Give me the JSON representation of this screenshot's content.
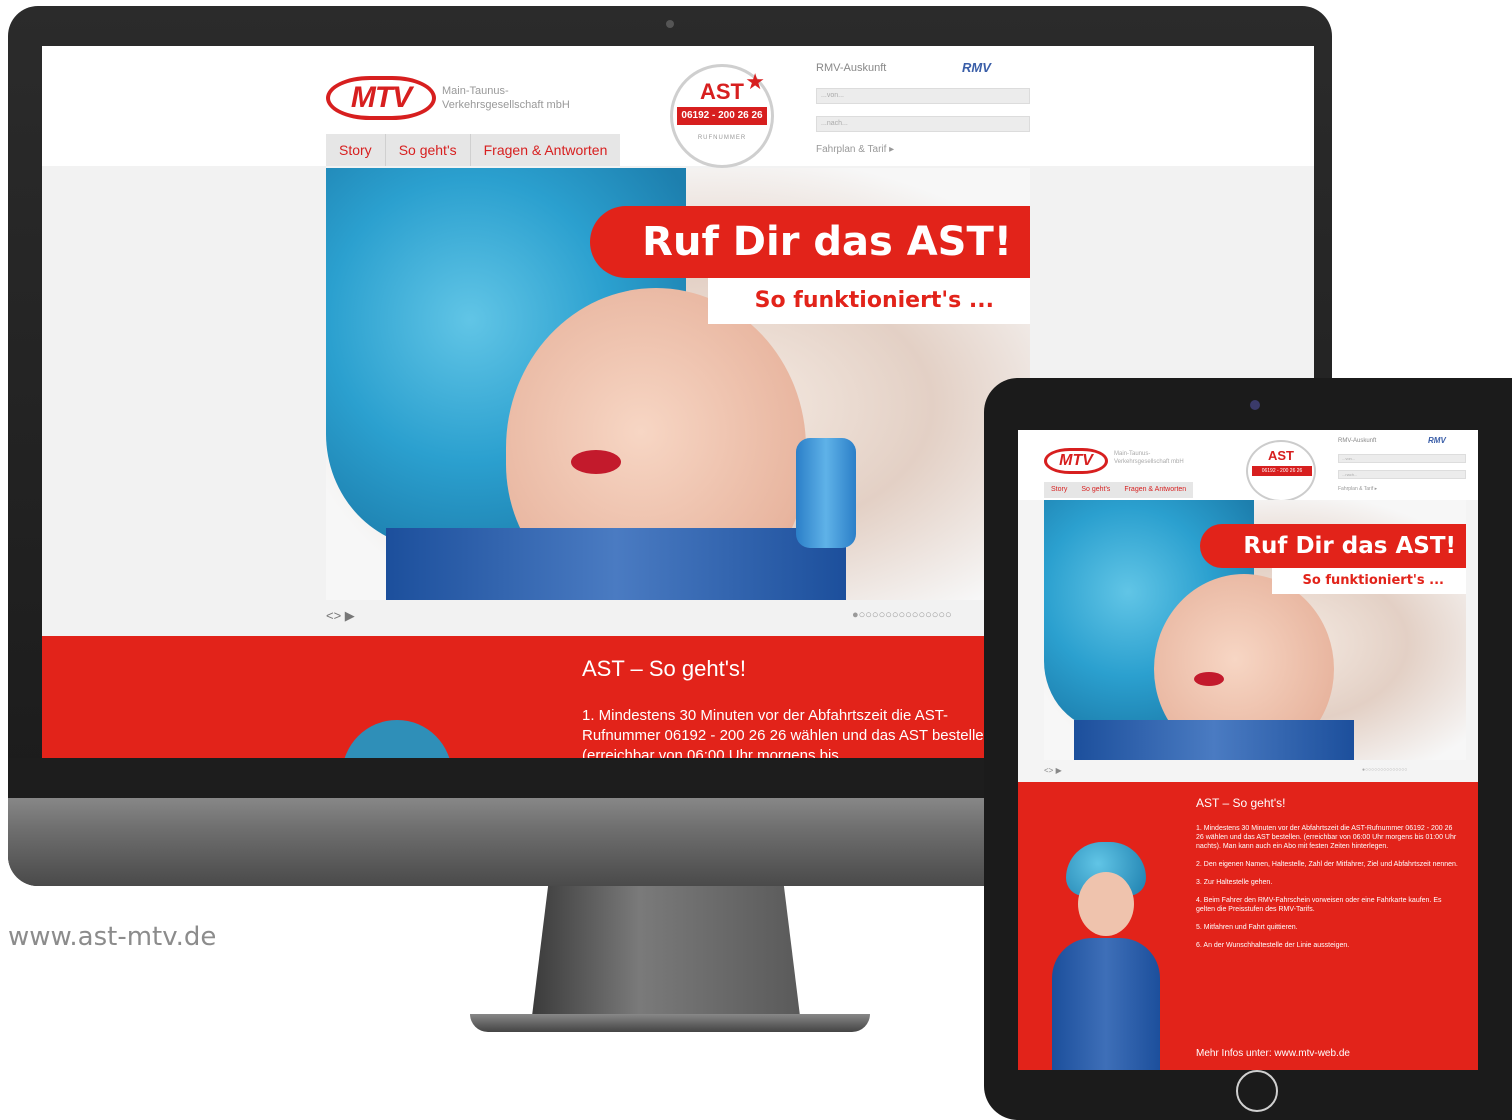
{
  "site": {
    "logo_mark": "MTV",
    "logo_text_line1": "Main-Taunus-",
    "logo_text_line2": "Verkehrsgesellschaft mbH",
    "badge_title": "AST",
    "badge_star": "★",
    "badge_phone": "06192 - 200 26 26",
    "badge_sub": "RUFNUMMER",
    "rmv_title": "RMV-Auskunft",
    "rmv_logo": "RMV",
    "rmv_from_placeholder": "...von...",
    "rmv_to_placeholder": "...nach...",
    "rmv_link": "Fahrplan & Tarif ▸",
    "nav": [
      "Story",
      "So geht's",
      "Fragen & Antworten"
    ],
    "hero_headline": "Ruf Dir das AST!",
    "hero_subline": "So funktioniert's ...",
    "slider_controls": "<> ▶",
    "slider_dots": "●○○○○○○○○○○○○○○",
    "section_heading": "AST – So geht's!",
    "desktop_step_1": "1. Mindestens 30 Minuten vor der Abfahrtszeit die AST-Rufnummer 06192 - 200 26 26 wählen und das AST bestellen. (erreichbar von 06:00 Uhr morgens bis",
    "steps": [
      "1. Mindestens 30 Minuten vor der Abfahrtszeit die AST-Rufnummer 06192 - 200 26 26 wählen und das AST bestellen. (erreichbar von 06:00 Uhr morgens bis 01:00 Uhr nachts). Man kann auch ein Abo mit festen Zeiten hinterlegen.",
      "2. Den eigenen Namen, Haltestelle, Zahl der Mitfahrer, Ziel und Abfahrtszeit nennen.",
      "3. Zur Haltestelle gehen.",
      "4. Beim Fahrer den RMV-Fahrschein vorweisen oder eine Fahrkarte kaufen. Es gelten die Preisstufen des RMV-Tarifs.",
      "5. Mitfahren und Fahrt quittieren.",
      "6. An der Wunschhaltestelle der Linie aussteigen."
    ],
    "more_info": "Mehr Infos unter: www.mtv-web.de"
  },
  "watermark_url": "www.ast-mtv.de",
  "colors": {
    "brand_red": "#e2231a",
    "rmv_blue": "#3a5ea8"
  }
}
